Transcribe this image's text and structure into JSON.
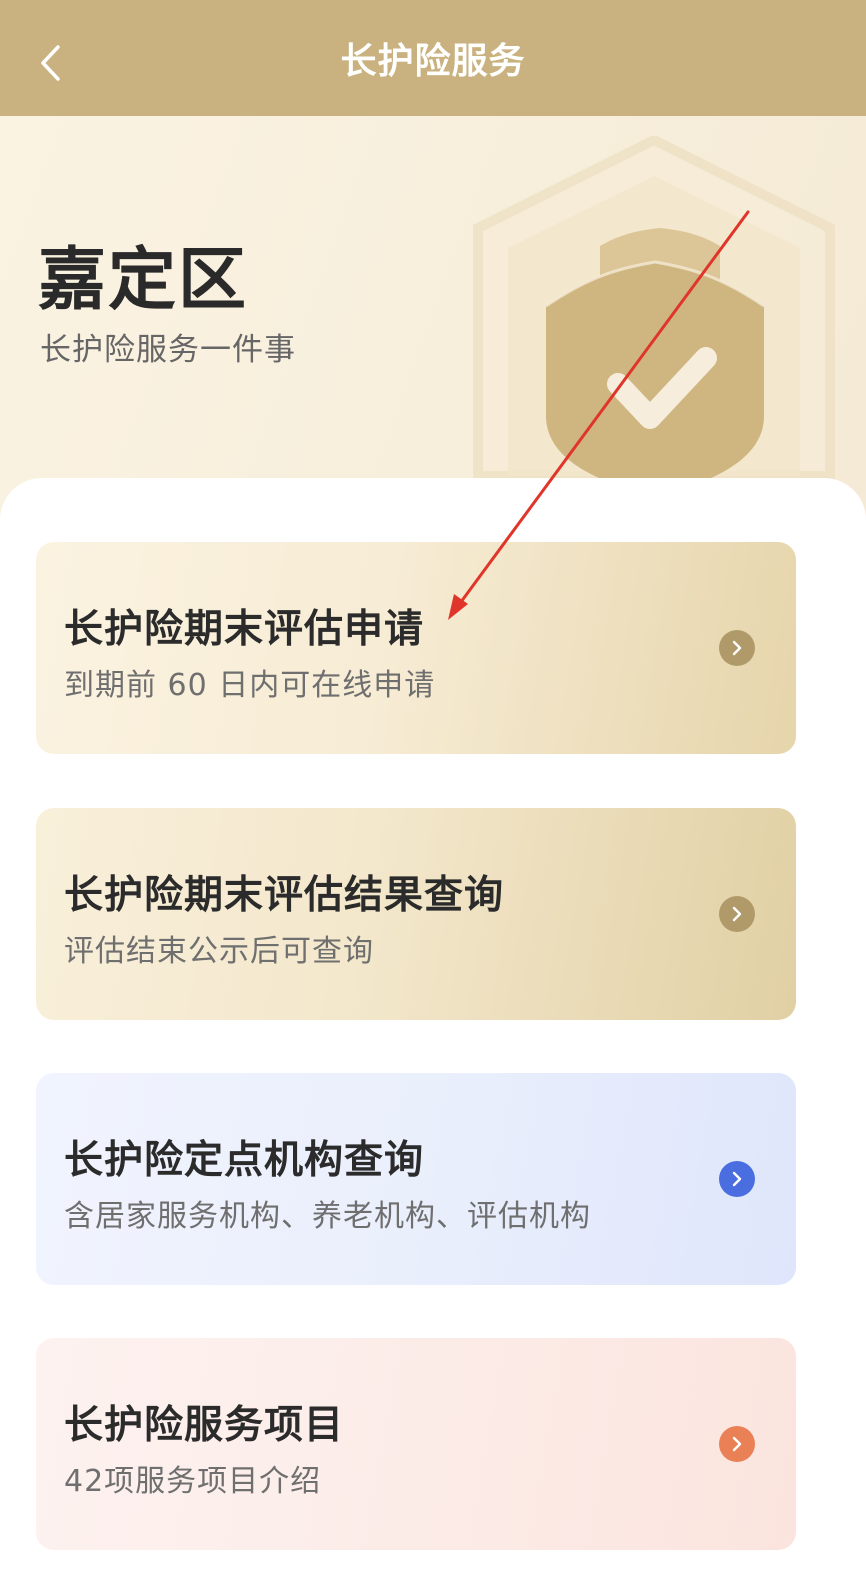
{
  "navbar": {
    "title": "长护险服务",
    "back_icon": "chevron-left-icon"
  },
  "hero": {
    "title": "嘉定区",
    "subtitle": "长护险服务一件事",
    "emblem_icon": "shield-check-icon"
  },
  "cards": [
    {
      "title": "长护险期末评估申请",
      "desc": "到期前 60 日内可在线申请",
      "arrow_color": "#b09a6a"
    },
    {
      "title": "长护险期末评估结果查询",
      "desc": "评估结束公示后可查询",
      "arrow_color": "#b09a6a"
    },
    {
      "title": "长护险定点机构查询",
      "desc": "含居家服务机构、养老机构、评估机构",
      "arrow_color": "#4a6ee0"
    },
    {
      "title": "长护险服务项目",
      "desc": "42项服务项目介绍",
      "arrow_color": "#ea8156"
    }
  ],
  "colors": {
    "navbar_bg": "#c9b280",
    "annotation_arrow": "#e0352b"
  }
}
